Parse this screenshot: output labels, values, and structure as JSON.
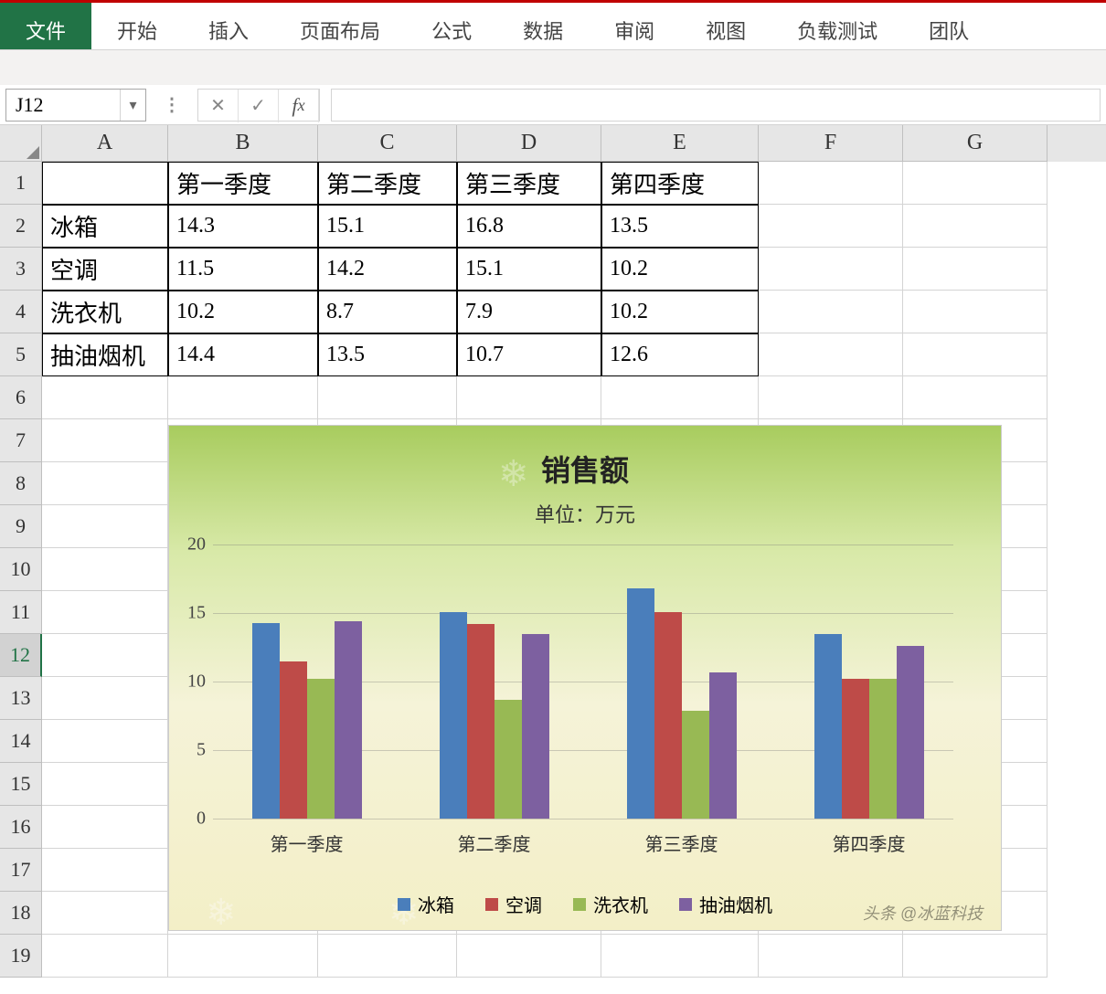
{
  "ribbon": {
    "tabs": [
      "文件",
      "开始",
      "插入",
      "页面布局",
      "公式",
      "数据",
      "审阅",
      "视图",
      "负载测试",
      "团队"
    ],
    "active_index": 0
  },
  "namebox": {
    "value": "J12"
  },
  "formula_bar": {
    "value": ""
  },
  "columns": [
    "A",
    "B",
    "C",
    "D",
    "E",
    "F",
    "G"
  ],
  "row_numbers": [
    1,
    2,
    3,
    4,
    5,
    6,
    7,
    8,
    9,
    10,
    11,
    12,
    13,
    14,
    15,
    16,
    17,
    18,
    19
  ],
  "active_row": 12,
  "table": {
    "headers": [
      "",
      "第一季度",
      "第二季度",
      "第三季度",
      "第四季度"
    ],
    "rows": [
      {
        "label": "冰箱",
        "values": [
          "14.3",
          "15.1",
          "16.8",
          "13.5"
        ]
      },
      {
        "label": "空调",
        "values": [
          "11.5",
          "14.2",
          "15.1",
          "10.2"
        ]
      },
      {
        "label": "洗衣机",
        "values": [
          "10.2",
          "8.7",
          "7.9",
          "10.2"
        ]
      },
      {
        "label": "抽油烟机",
        "values": [
          "14.4",
          "13.5",
          "10.7",
          "12.6"
        ]
      }
    ]
  },
  "chart_data": {
    "type": "bar",
    "title": "销售额",
    "subtitle": "单位：万元",
    "categories": [
      "第一季度",
      "第二季度",
      "第三季度",
      "第四季度"
    ],
    "series": [
      {
        "name": "冰箱",
        "values": [
          14.3,
          15.1,
          16.8,
          13.5
        ],
        "color": "#4a7ebb"
      },
      {
        "name": "空调",
        "values": [
          11.5,
          14.2,
          15.1,
          10.2
        ],
        "color": "#be4b48"
      },
      {
        "name": "洗衣机",
        "values": [
          10.2,
          8.7,
          7.9,
          10.2
        ],
        "color": "#98b954"
      },
      {
        "name": "抽油烟机",
        "values": [
          14.4,
          13.5,
          10.7,
          12.6
        ],
        "color": "#7d60a0"
      }
    ],
    "yticks": [
      0,
      5,
      10,
      15,
      20
    ],
    "ylim": [
      0,
      20
    ],
    "xlabel": "",
    "ylabel": ""
  },
  "watermark": "头条 @冰蓝科技"
}
